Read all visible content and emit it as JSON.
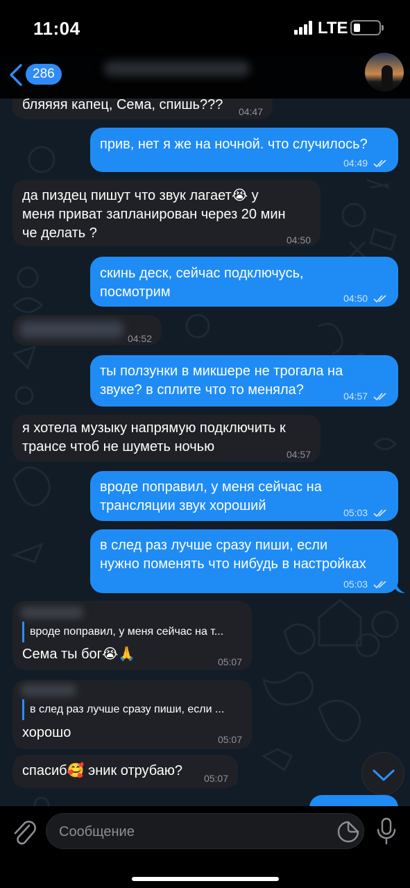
{
  "status_bar": {
    "time": "11:04",
    "network": "LTE"
  },
  "header": {
    "unread_count": "286"
  },
  "messages": [
    {
      "dir": "in",
      "text": "бляяяя капец, Сема, спишь???",
      "time": "04:47"
    },
    {
      "dir": "out",
      "text": "прив, нет я же на ночной. что случилось?",
      "time": "04:49",
      "read": true
    },
    {
      "dir": "in",
      "lines": [
        "да пиздец пишут что звук лагает😭 у",
        "меня приват запланирован через 20 мин",
        "че делать ?"
      ],
      "time": "04:50"
    },
    {
      "dir": "out",
      "lines": [
        "скинь деск, сейчас подключусь,",
        "посмотрим"
      ],
      "time": "04:50",
      "read": true
    },
    {
      "dir": "in",
      "text": "",
      "time": "04:52",
      "redacted": true
    },
    {
      "dir": "out",
      "lines": [
        "ты ползунки в микшере не трогала на",
        "звуке? в сплите что то меняла?"
      ],
      "time": "04:57",
      "read": true
    },
    {
      "dir": "in",
      "lines": [
        "я хотела музыку напрямую подключить к",
        "трансе чтоб не шуметь ночью"
      ],
      "time": "04:57"
    },
    {
      "dir": "out",
      "lines": [
        "вроде поправил, у меня сейчас на",
        "трансляции звук хороший"
      ],
      "time": "05:03",
      "read": true
    },
    {
      "dir": "out",
      "lines": [
        "в след раз лучше сразу пиши, если",
        "нужно поменять что нибудь в настройках"
      ],
      "time": "05:03",
      "read": true
    },
    {
      "dir": "in",
      "reply": "вроде поправил, у меня сейчас на т...",
      "text": "Сема ты бог😭🙏",
      "time": "05:07"
    },
    {
      "dir": "in",
      "reply": "в след раз лучше сразу пиши, если ...",
      "text": "хорошо",
      "time": "05:07"
    },
    {
      "dir": "in",
      "text": "спасиб🥰 эник отрубаю?",
      "time": "05:07"
    }
  ],
  "input": {
    "placeholder": "Сообщение"
  },
  "icons": {
    "back": "chevron-left-icon",
    "attach": "paperclip-icon",
    "sticker": "sticker-icon",
    "mic": "microphone-icon",
    "scroll_down": "chevron-down-icon",
    "read_status": "double-check-icon"
  },
  "colors": {
    "accent": "#2f8bf6",
    "outgoing_bubble": "#1f8cf5",
    "incoming_bubble": "#1f2126",
    "chat_background": "#111c26"
  }
}
